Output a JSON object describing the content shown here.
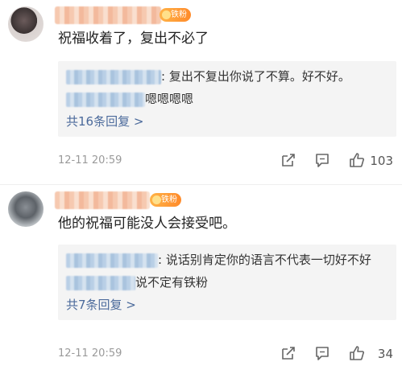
{
  "comments": [
    {
      "badge": "铁粉",
      "text": "祝福收着了，复出不必了",
      "replies": [
        {
          "text": ": 复出不复出你说了不算。好不好。"
        },
        {
          "text": "嗯嗯嗯嗯"
        }
      ],
      "more_replies": "共16条回复 >",
      "timestamp": "12-11 20:59",
      "likes": "103"
    },
    {
      "badge": "铁粉",
      "text": "他的祝福可能没人会接受吧。",
      "replies": [
        {
          "text": ": 说话别肯定你的语言不代表一切好不好"
        },
        {
          "text": "说不定有铁粉"
        }
      ],
      "more_replies": "共7条回复 >",
      "timestamp": "12-11 20:59",
      "likes": "34"
    }
  ],
  "colors": {
    "link": "#4b6a9b",
    "reply_bg": "#f4f4f4",
    "timestamp": "#9a9a9a",
    "badge": "#ff8a2a"
  },
  "icons": [
    "share-icon",
    "comment-icon",
    "like-icon"
  ]
}
